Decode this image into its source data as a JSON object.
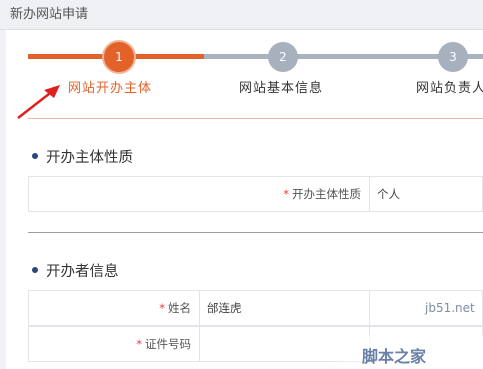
{
  "window": {
    "title": "新办网站申请"
  },
  "steps": [
    {
      "number": "1",
      "label": "网站开办主体",
      "state": "active"
    },
    {
      "number": "2",
      "label": "网站基本信息",
      "state": "pending"
    },
    {
      "number": "3",
      "label": "网站负责人",
      "state": "pending"
    }
  ],
  "colors": {
    "accent": "#e2622a",
    "pending": "#a7b0bd",
    "required": "#e23c3c",
    "bullet": "#27477d"
  },
  "sections": {
    "subject_type": {
      "title": "开办主体性质",
      "field_label": "开办主体性质",
      "required_mark": "*",
      "value": "个人"
    },
    "operator_info": {
      "title": "开办者信息",
      "rows": [
        {
          "required_mark": "*",
          "label": "姓名",
          "value": "邰连虎"
        },
        {
          "required_mark": "*",
          "label": "证件号码",
          "value": ""
        }
      ]
    }
  },
  "watermark": {
    "site": "jb51.net",
    "text": "脚本之家"
  }
}
